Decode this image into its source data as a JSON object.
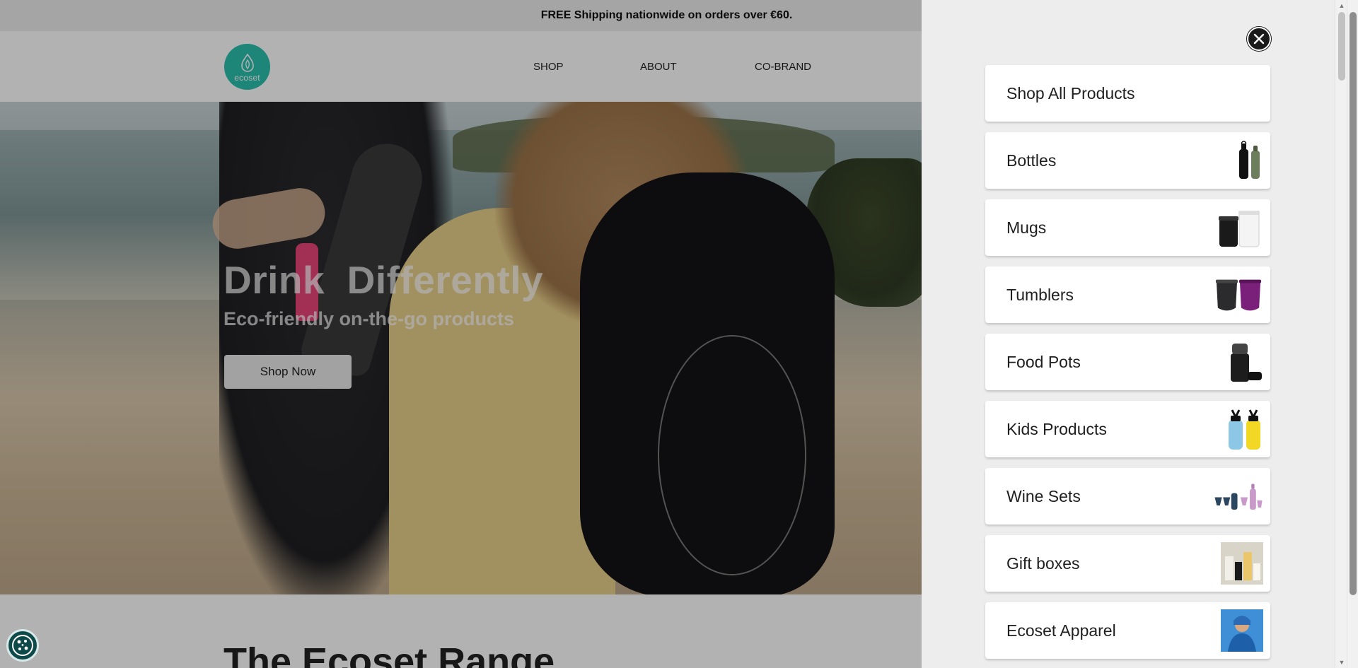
{
  "announcement": {
    "text": "FREE Shipping nationwide on orders over €60."
  },
  "logo": {
    "text": "ecoset",
    "color": "#2bbfae"
  },
  "nav": {
    "items": [
      "SHOP",
      "ABOUT",
      "CO-BRAND"
    ]
  },
  "hero": {
    "title": "Drink  Differently",
    "subtitle": "Eco-friendly on-the-go products",
    "cta_label": "Shop Now"
  },
  "section": {
    "title": "The Ecoset Range"
  },
  "drawer": {
    "close_icon": "close-icon",
    "items": [
      {
        "label": "Shop All Products",
        "thumb": ""
      },
      {
        "label": "Bottles",
        "thumb": "bottles"
      },
      {
        "label": "Mugs",
        "thumb": "mugs"
      },
      {
        "label": "Tumblers",
        "thumb": "tumblers"
      },
      {
        "label": "Food Pots",
        "thumb": "food-pots"
      },
      {
        "label": "Kids Products",
        "thumb": "kids"
      },
      {
        "label": "Wine Sets",
        "thumb": "wine"
      },
      {
        "label": "Gift boxes",
        "thumb": "gift"
      },
      {
        "label": "Ecoset Apparel",
        "thumb": "apparel"
      }
    ]
  },
  "cookie": {
    "icon": "cookie-icon"
  }
}
